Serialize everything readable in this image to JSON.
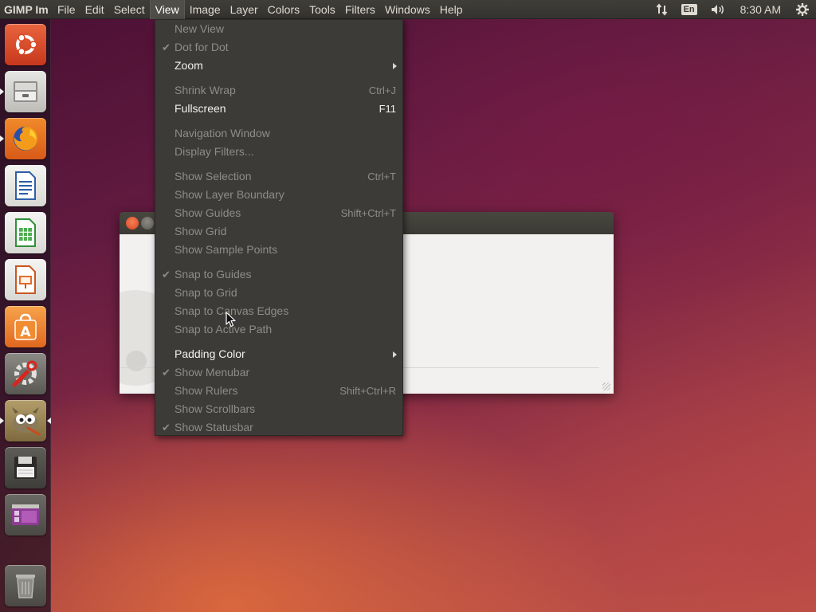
{
  "panel": {
    "app_title": "GIMP Im",
    "menus": [
      {
        "label": "File",
        "active": false
      },
      {
        "label": "Edit",
        "active": false
      },
      {
        "label": "Select",
        "active": false
      },
      {
        "label": "View",
        "active": true
      },
      {
        "label": "Image",
        "active": false
      },
      {
        "label": "Layer",
        "active": false
      },
      {
        "label": "Colors",
        "active": false
      },
      {
        "label": "Tools",
        "active": false
      },
      {
        "label": "Filters",
        "active": false
      },
      {
        "label": "Windows",
        "active": false
      },
      {
        "label": "Help",
        "active": false
      }
    ],
    "lang": "En",
    "clock": "8:30 AM"
  },
  "launcher": {
    "items": [
      "ubuntu-dash",
      "files",
      "firefox",
      "libreoffice-writer",
      "libreoffice-calc",
      "libreoffice-impress",
      "ubuntu-software",
      "system-settings",
      "gimp",
      "save-floppy",
      "workspace-switcher",
      "trash"
    ]
  },
  "view_menu": {
    "items": [
      {
        "label": "New View",
        "enabled": false,
        "checked": false,
        "accel": ""
      },
      {
        "label": "Dot for Dot",
        "enabled": false,
        "checked": true,
        "accel": ""
      },
      {
        "label": "Zoom",
        "enabled": true,
        "checked": false,
        "accel": "",
        "submenu": true
      },
      {
        "sep": true
      },
      {
        "label": "Shrink Wrap",
        "enabled": false,
        "checked": false,
        "accel": "Ctrl+J"
      },
      {
        "label": "Fullscreen",
        "enabled": true,
        "checked": false,
        "accel": "F11"
      },
      {
        "sep": true
      },
      {
        "label": "Navigation Window",
        "enabled": false,
        "checked": false,
        "accel": ""
      },
      {
        "label": "Display Filters...",
        "enabled": false,
        "checked": false,
        "accel": ""
      },
      {
        "sep": true
      },
      {
        "label": "Show Selection",
        "enabled": false,
        "checked": false,
        "accel": "Ctrl+T"
      },
      {
        "label": "Show Layer Boundary",
        "enabled": false,
        "checked": false,
        "accel": ""
      },
      {
        "label": "Show Guides",
        "enabled": false,
        "checked": false,
        "accel": "Shift+Ctrl+T"
      },
      {
        "label": "Show Grid",
        "enabled": false,
        "checked": false,
        "accel": ""
      },
      {
        "label": "Show Sample Points",
        "enabled": false,
        "checked": false,
        "accel": ""
      },
      {
        "sep": true
      },
      {
        "label": "Snap to Guides",
        "enabled": false,
        "checked": true,
        "accel": ""
      },
      {
        "label": "Snap to Grid",
        "enabled": false,
        "checked": false,
        "accel": ""
      },
      {
        "label": "Snap to Canvas Edges",
        "enabled": false,
        "checked": false,
        "accel": ""
      },
      {
        "label": "Snap to Active Path",
        "enabled": false,
        "checked": false,
        "accel": ""
      },
      {
        "sep": true
      },
      {
        "label": "Padding Color",
        "enabled": true,
        "checked": false,
        "accel": "",
        "submenu": true
      },
      {
        "label": "Show Menubar",
        "enabled": false,
        "checked": true,
        "accel": ""
      },
      {
        "label": "Show Rulers",
        "enabled": false,
        "checked": false,
        "accel": "Shift+Ctrl+R"
      },
      {
        "label": "Show Scrollbars",
        "enabled": false,
        "checked": false,
        "accel": ""
      },
      {
        "label": "Show Statusbar",
        "enabled": false,
        "checked": true,
        "accel": ""
      }
    ]
  },
  "colors": {
    "menu_bg": "#3c3b37",
    "enabled_text": "#f2f1ee",
    "disabled_text": "#8e8c86",
    "panel_bg": "#3a3935"
  }
}
